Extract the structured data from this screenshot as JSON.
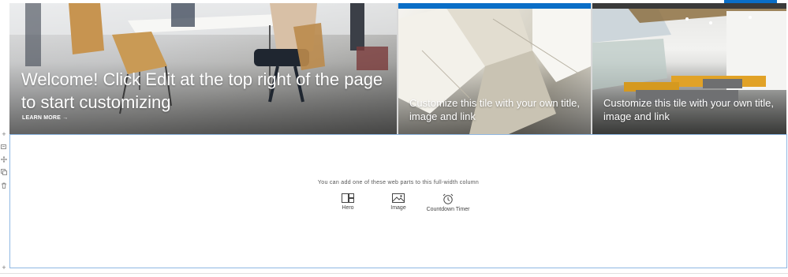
{
  "hero": {
    "main_tile": {
      "title": "Welcome! Click Edit at the top right of the page to start customizing",
      "link": "LEARN MORE"
    },
    "tiles": [
      {
        "title": "Customize this tile with your own title, image and link"
      },
      {
        "title": "Customize this tile with your own title, image and link"
      }
    ]
  },
  "section": {
    "hint": "You can add one of these web parts to this full-width column",
    "web_parts": [
      {
        "label": "Hero",
        "icon": "hero-layout-icon"
      },
      {
        "label": "Image",
        "icon": "image-icon"
      },
      {
        "label": "Countdown Timer",
        "icon": "alarm-clock-icon"
      }
    ]
  },
  "toolbar": {
    "icons": [
      "add-icon",
      "edit-icon",
      "move-icon",
      "duplicate-icon",
      "delete-icon",
      "add-icon"
    ]
  },
  "colors": {
    "accent": "#0a6ec7",
    "section_border": "#8fb8e3"
  }
}
